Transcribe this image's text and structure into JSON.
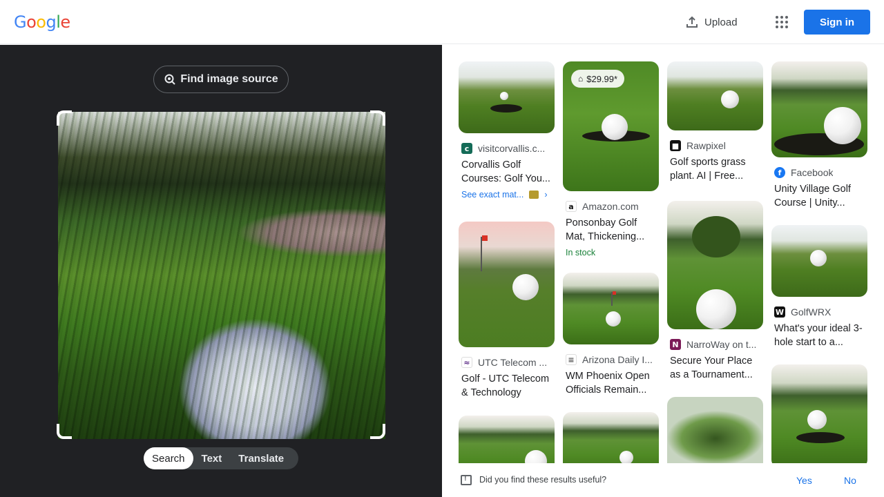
{
  "header": {
    "logo_letters": [
      {
        "ch": "G",
        "color": "#4285f4"
      },
      {
        "ch": "o",
        "color": "#ea4335"
      },
      {
        "ch": "o",
        "color": "#fbbc05"
      },
      {
        "ch": "g",
        "color": "#4285f4"
      },
      {
        "ch": "l",
        "color": "#34a853"
      },
      {
        "ch": "e",
        "color": "#ea4335"
      }
    ],
    "upload_label": "Upload",
    "apps_icon": "apps-grid-icon",
    "signin_label": "Sign in",
    "accent": "#1a73e8"
  },
  "left_panel": {
    "find_source_label": "Find image source",
    "find_icon": "lens-search-icon",
    "modes": [
      {
        "label": "Search",
        "active": true
      },
      {
        "label": "Text",
        "active": false
      },
      {
        "label": "Translate",
        "active": false
      }
    ],
    "background": "#202124"
  },
  "results": {
    "columns": [
      [
        {
          "source": "visitcorvallis.c...",
          "favicon": "visitcorvallis-favicon",
          "title": "Corvallis Golf Courses: Golf You...",
          "extra_type": "exact",
          "extra": "See exact mat..."
        },
        {
          "source": "UTC Telecom ...",
          "favicon": "utc-telecom-favicon",
          "title": "Golf - UTC Telecom & Technology"
        }
      ],
      [
        {
          "source": "Amazon.com",
          "favicon": "amazon-favicon",
          "title": "Ponsonbay Golf Mat, Thickening...",
          "price": "$29.99*",
          "extra_type": "stock",
          "extra": "In stock"
        },
        {
          "source": "Arizona Daily I...",
          "favicon": "arizona-daily-favicon",
          "title": "WM Phoenix Open Officials Remain..."
        }
      ],
      [
        {
          "source": "Rawpixel",
          "favicon": "rawpixel-favicon",
          "title": "Golf sports grass plant. AI | Free..."
        },
        {
          "source": "NarroWay on t...",
          "favicon": "narroway-favicon",
          "title": "Secure Your Place as a Tournament..."
        }
      ],
      [
        {
          "source": "Facebook",
          "favicon": "facebook-favicon",
          "title": "Unity Village Golf Course | Unity..."
        },
        {
          "source": "GolfWRX",
          "favicon": "golfwrx-favicon",
          "title": "What's your ideal 3-hole start to a..."
        }
      ]
    ]
  },
  "feedback": {
    "question": "Did you find these results useful?",
    "yes": "Yes",
    "no": "No"
  }
}
